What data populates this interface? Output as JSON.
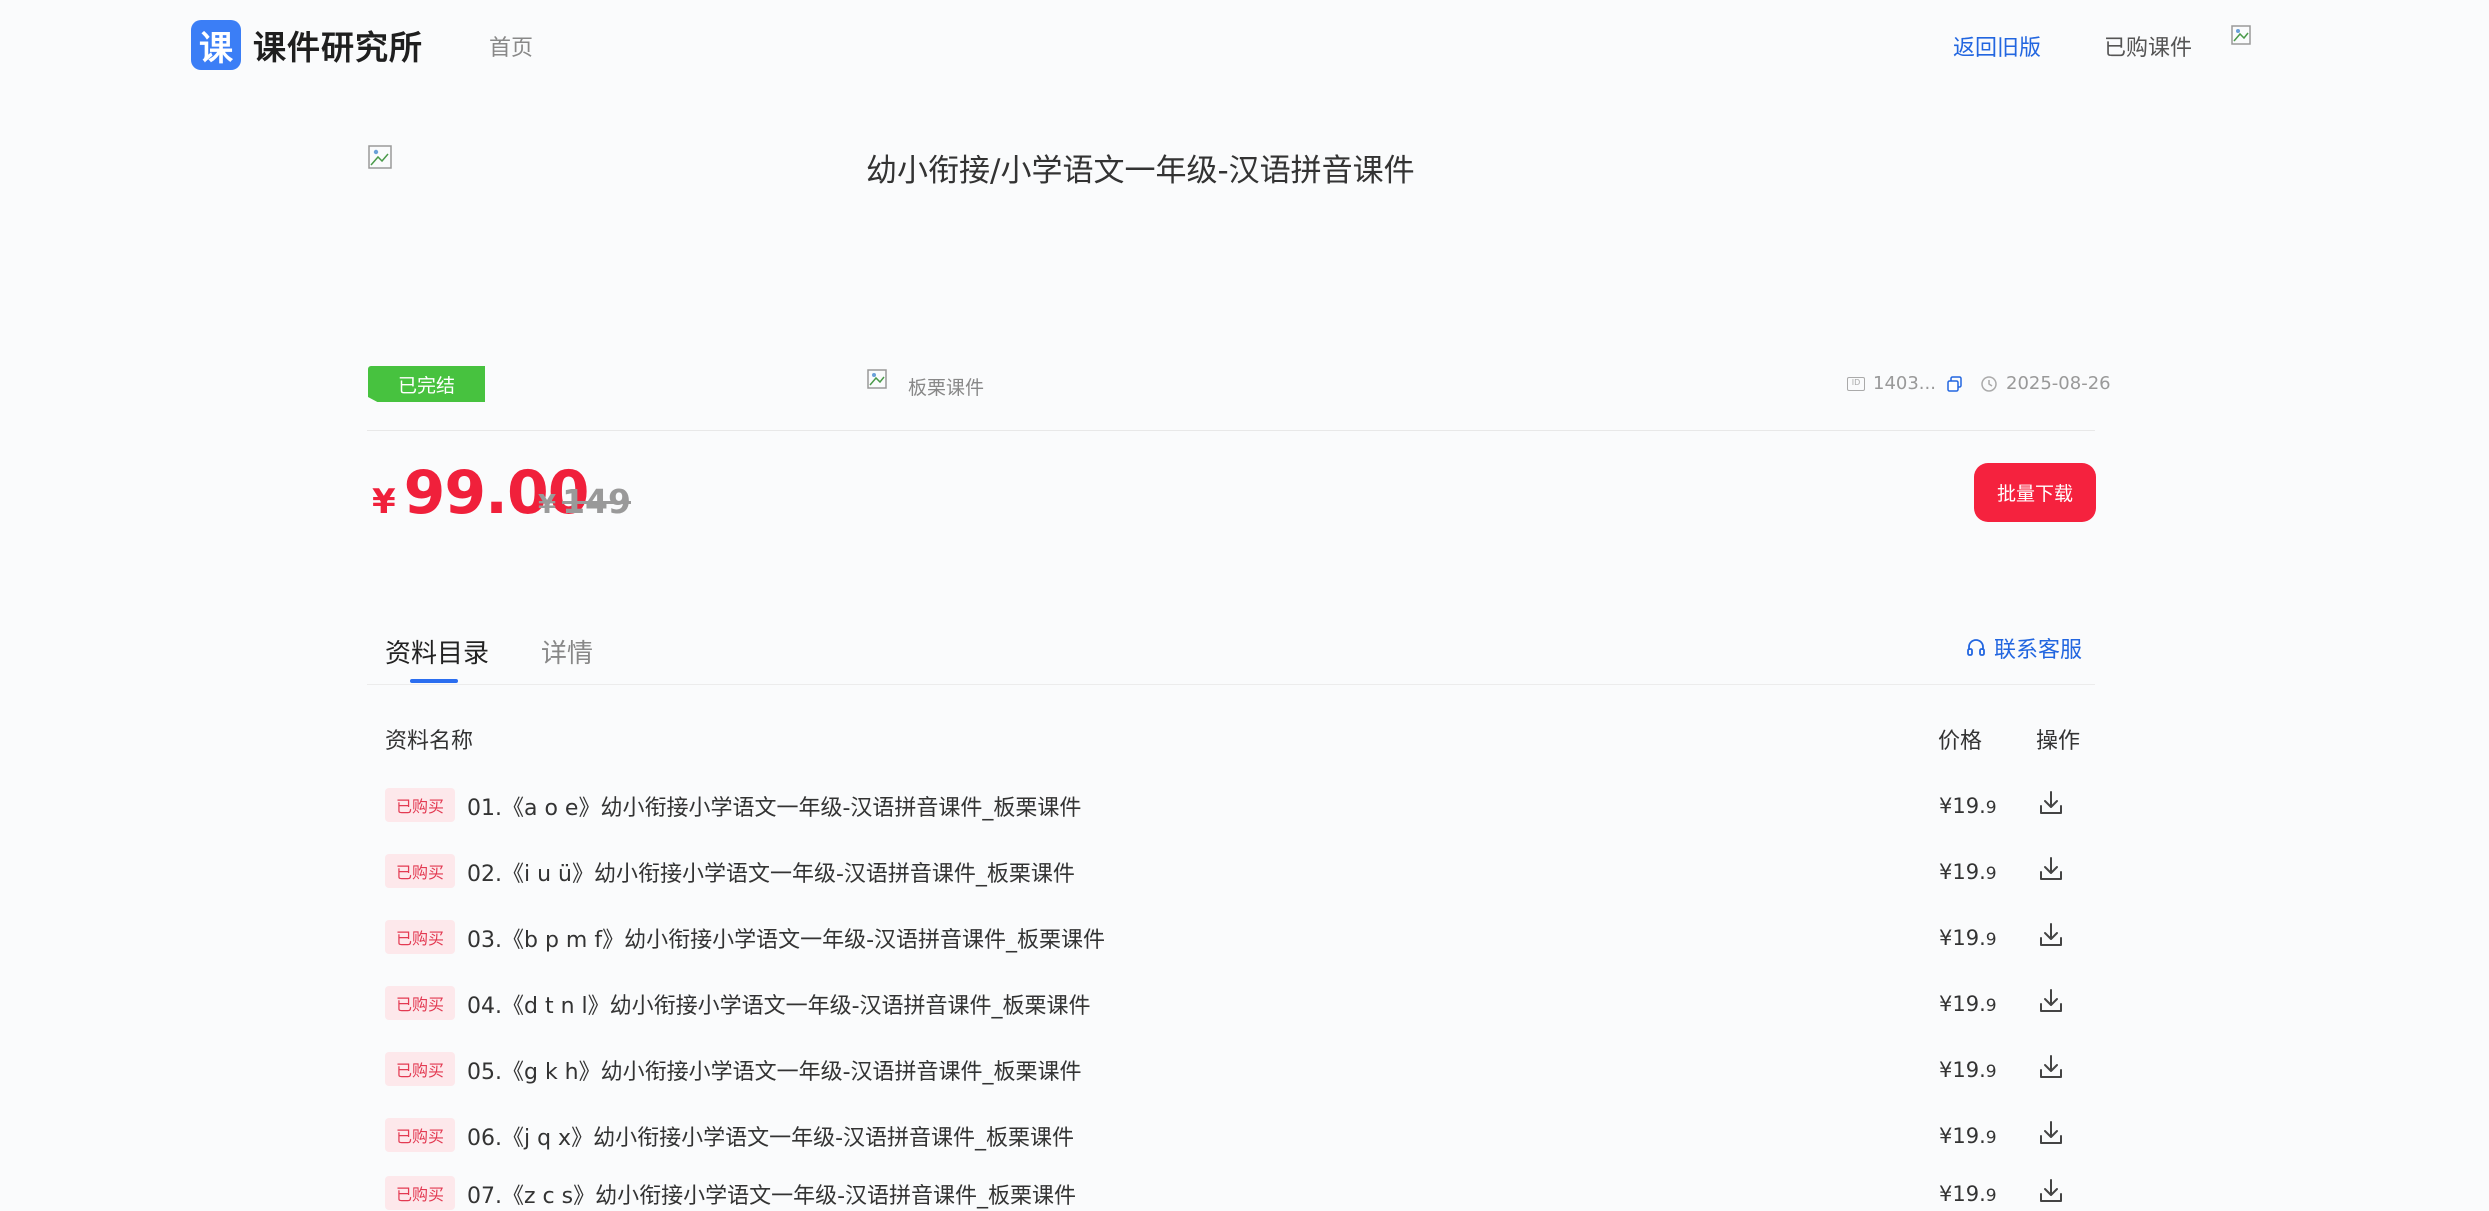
{
  "nav": {
    "logo_mark": "课",
    "logo_text": "课件研究所",
    "home": "首页",
    "old_version": "返回旧版",
    "purchased": "已购课件"
  },
  "course": {
    "title": "幼小衔接/小学语文一年级-汉语拼音课件",
    "status": "已完结",
    "seller": "板栗课件",
    "id": "1403...",
    "date": "2025-08-26",
    "price_symbol": "¥",
    "price": "99.00",
    "orig_symbol": "¥",
    "orig_price": "149",
    "batch_download": "批量下载"
  },
  "tabs": {
    "catalog": "资料目录",
    "detail": "详情",
    "service": "联系客服"
  },
  "table": {
    "col_name": "资料名称",
    "col_price": "价格",
    "col_op": "操作",
    "rows": [
      {
        "tag": "已购买",
        "title": "01.《a o e》幼小衔接小学语文一年级-汉语拼音课件_板栗课件",
        "price_main": "¥19.",
        "price_dec": "9"
      },
      {
        "tag": "已购买",
        "title": "02.《i u ü》幼小衔接小学语文一年级-汉语拼音课件_板栗课件",
        "price_main": "¥19.",
        "price_dec": "9"
      },
      {
        "tag": "已购买",
        "title": "03.《b p m f》幼小衔接小学语文一年级-汉语拼音课件_板栗课件",
        "price_main": "¥19.",
        "price_dec": "9"
      },
      {
        "tag": "已购买",
        "title": "04.《d t n l》幼小衔接小学语文一年级-汉语拼音课件_板栗课件",
        "price_main": "¥19.",
        "price_dec": "9"
      },
      {
        "tag": "已购买",
        "title": "05.《g k h》幼小衔接小学语文一年级-汉语拼音课件_板栗课件",
        "price_main": "¥19.",
        "price_dec": "9"
      },
      {
        "tag": "已购买",
        "title": "06.《j q x》幼小衔接小学语文一年级-汉语拼音课件_板栗课件",
        "price_main": "¥19.",
        "price_dec": "9"
      },
      {
        "tag": "已购买",
        "title": "07.《z c s》幼小衔接小学语文一年级-汉语拼音课件_板栗课件",
        "price_main": "¥19.",
        "price_dec": "9"
      }
    ]
  },
  "colors": {
    "accent_blue": "#2266e0",
    "price_red": "#f0203b",
    "status_green": "#47c23f"
  }
}
